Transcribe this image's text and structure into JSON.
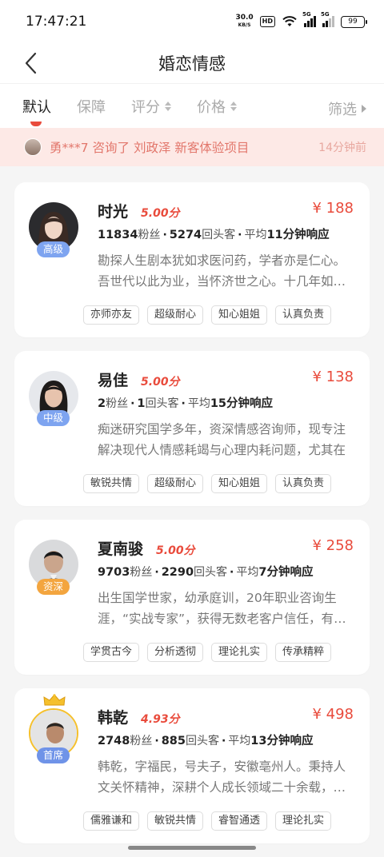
{
  "status_bar": {
    "time": "17:47:21",
    "net_speed": "30.0",
    "net_unit": "KB/S",
    "hd": "HD",
    "sig1_label": "5G",
    "sig2_label": "5G",
    "battery": "99"
  },
  "nav": {
    "title": "婚恋情感",
    "back_icon": "chevron-left-icon"
  },
  "filters": {
    "tabs": [
      {
        "label": "默认",
        "active": true
      },
      {
        "label": "保障"
      },
      {
        "label": "评分"
      },
      {
        "label": "价格"
      }
    ],
    "more_label": "筛选"
  },
  "notice": {
    "text": "勇***7 咨询了 刘政泽 新客体验项目",
    "time": "14分钟前"
  },
  "consultants": [
    {
      "name": "时光",
      "rating": "5.00分",
      "price": "¥ 188",
      "level": "高级",
      "level_color": "#7ea4f0",
      "fans_num": "11834",
      "fans_unit": "粉丝",
      "repeat_num": "5274",
      "repeat_unit": "回头客",
      "resp_prefix": "平均",
      "resp_num": "11分钟响应",
      "desc": "勘探人生剧本犹如求医问药，学者亦是仁心。吾世代以此为业，当怀济世之心。十几年如一日",
      "tags": [
        "亦师亦友",
        "超级耐心",
        "知心姐姐",
        "认真负责"
      ]
    },
    {
      "name": "易佳",
      "rating": "5.00分",
      "price": "¥ 138",
      "level": "中级",
      "level_color": "#7ea4f0",
      "fans_num": "2",
      "fans_unit": "粉丝",
      "repeat_num": "1",
      "repeat_unit": "回头客",
      "resp_prefix": "平均",
      "resp_num": "15分钟响应",
      "desc": "痴迷研究国学多年，资深情感咨询师，现专注解决现代人情感耗竭与心理内耗问题，尤其在",
      "tags": [
        "敏锐共情",
        "超级耐心",
        "知心姐姐",
        "认真负责"
      ]
    },
    {
      "name": "夏南骏",
      "rating": "5.00分",
      "price": "¥ 258",
      "level": "资深",
      "level_color": "#f3a53f",
      "fans_num": "9703",
      "fans_unit": "粉丝",
      "repeat_num": "2290",
      "repeat_unit": "回头客",
      "resp_prefix": "平均",
      "resp_num": "7分钟响应",
      "desc": "出生国学世家，幼承庭训，20年职业咨询生涯，“实战专家”，获得无数老客户信任，有自己",
      "tags": [
        "学贯古今",
        "分析透彻",
        "理论扎实",
        "传承精粹"
      ]
    },
    {
      "name": "韩乾",
      "rating": "4.93分",
      "price": "¥ 498",
      "level": "首席",
      "level_color": "#6f93e8",
      "fans_num": "2748",
      "fans_unit": "粉丝",
      "repeat_num": "885",
      "repeat_unit": "回头客",
      "resp_prefix": "平均",
      "resp_num": "13分钟响应",
      "desc": "韩乾，字福民，号夫子，安徽亳州人。秉持人文关怀精神，深耕个人成长领域二十余载，专注",
      "tags": [
        "儒雅谦和",
        "敏锐共情",
        "睿智通透",
        "理论扎实"
      ]
    }
  ]
}
